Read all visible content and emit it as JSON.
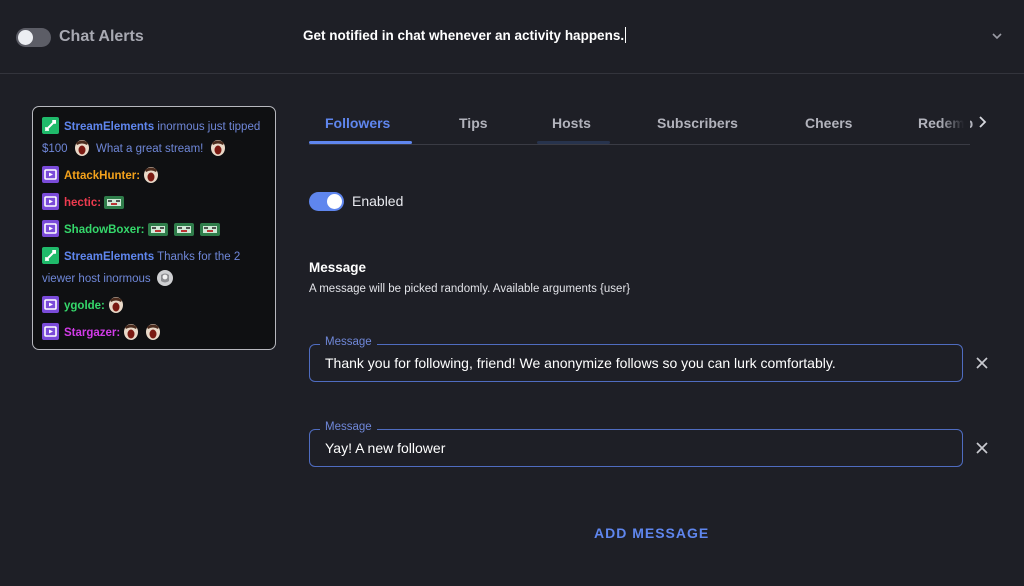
{
  "header": {
    "toggle_state": "off",
    "title": "Chat Alerts",
    "description": "Get notified in chat whenever an activity happens."
  },
  "preview": {
    "lines": [
      {
        "badge": "streamelements-badge",
        "user": "StreamElements",
        "user_color": "#5f86ee",
        "text": " inormous just tipped"
      },
      {
        "text": "$100 ",
        "text2": " What a great stream! "
      },
      {
        "badge": "twitch-badge",
        "user": "AttackHunter:",
        "user_color": "#f4a21c"
      },
      {
        "badge": "twitch-badge",
        "user": "hectic:",
        "user_color": "#ee3b4f"
      },
      {
        "badge": "twitch-badge",
        "user": "ShadowBoxer:",
        "user_color": "#35d86b"
      },
      {
        "badge": "streamelements-badge",
        "user": "StreamElements",
        "user_color": "#5f86ee",
        "text": " Thanks for the 2"
      },
      {
        "text": "viewer host inormous "
      },
      {
        "badge": "twitch-badge",
        "user": "ygolde:",
        "user_color": "#35d86b"
      },
      {
        "badge": "twitch-badge",
        "user": "Stargazer:",
        "user_color": "#d23be8"
      }
    ]
  },
  "tabs": [
    {
      "label": "Followers",
      "active": true
    },
    {
      "label": "Tips"
    },
    {
      "label": "Hosts"
    },
    {
      "label": "Subscribers"
    },
    {
      "label": "Cheers"
    },
    {
      "label": "Redemp"
    }
  ],
  "enabled": {
    "state": "on",
    "label": "Enabled"
  },
  "messages_section": {
    "title": "Message",
    "help": "A message will be picked randomly. Available arguments {user}"
  },
  "fields": [
    {
      "legend": "Message",
      "value": "Thank you for following, friend!  We anonymize follows so you can lurk comfortably."
    },
    {
      "legend": "Message",
      "value": "Yay! A new follower"
    }
  ],
  "add_button": "ADD MESSAGE",
  "colors": {
    "accent": "#5f86ee",
    "background": "#1e1f26",
    "streamelements_green": "#1fba6a",
    "twitch_purple": "#7a4bd9"
  }
}
